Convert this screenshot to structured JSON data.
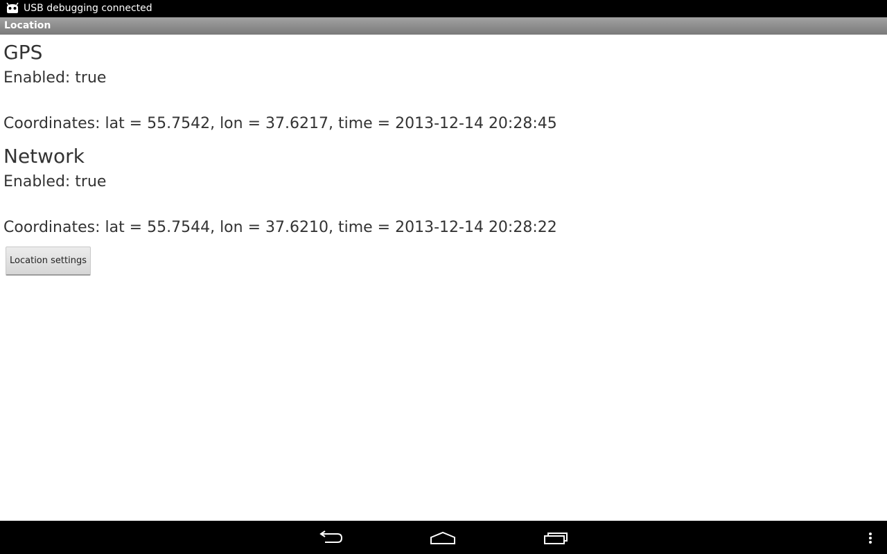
{
  "status_bar": {
    "notification_icon": "android-debug-icon",
    "text": "USB debugging connected"
  },
  "action_bar": {
    "title": "Location"
  },
  "gps": {
    "title": "GPS",
    "enabled": "Enabled: true",
    "coordinates": "Coordinates: lat = 55.7542, lon = 37.6217, time = 2013-12-14 20:28:45"
  },
  "network": {
    "title": "Network",
    "enabled": "Enabled: true",
    "coordinates": "Coordinates: lat = 55.7544, lon = 37.6210, time = 2013-12-14 20:28:22"
  },
  "actions": {
    "location_settings_label": "Location settings"
  },
  "nav_bar": {
    "back_icon": "back-icon",
    "home_icon": "home-icon",
    "recents_icon": "recents-icon",
    "menu_icon": "overflow-menu-icon"
  },
  "colors": {
    "status_bar_bg": "#000000",
    "title_bar_bg": "#8a8a8a",
    "text": "#333333"
  }
}
